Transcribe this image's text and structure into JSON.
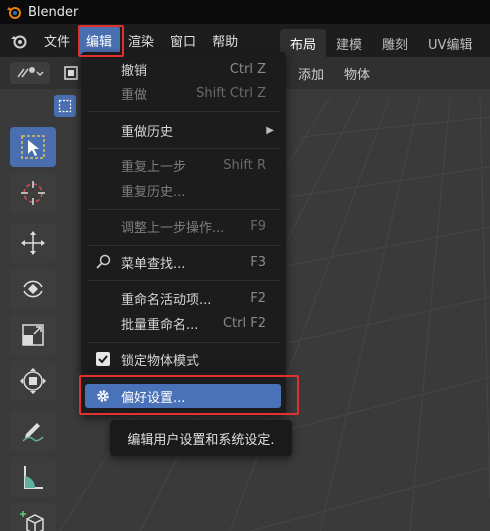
{
  "window": {
    "title": "Blender"
  },
  "menubar": {
    "items": [
      {
        "label": "文件"
      },
      {
        "label": "编辑"
      },
      {
        "label": "渲染"
      },
      {
        "label": "窗口"
      },
      {
        "label": "帮助"
      }
    ],
    "active_index": 1
  },
  "workspaces": [
    {
      "label": "布局"
    },
    {
      "label": "建模"
    },
    {
      "label": "雕刻"
    },
    {
      "label": "UV编辑"
    }
  ],
  "viewport_header": {
    "add_label": "添加",
    "object_label": "物体"
  },
  "edit_menu": {
    "undo": {
      "label": "撤销",
      "shortcut": "Ctrl Z"
    },
    "redo": {
      "label": "重做",
      "shortcut": "Shift Ctrl Z"
    },
    "undo_history": {
      "label": "重做历史"
    },
    "repeat_last": {
      "label": "重复上一步",
      "shortcut": "Shift R"
    },
    "repeat_history": {
      "label": "重复历史..."
    },
    "adjust_last": {
      "label": "调整上一步操作...",
      "shortcut": "F9"
    },
    "menu_search": {
      "label": "菜单查找...",
      "shortcut": "F3"
    },
    "rename_active": {
      "label": "重命名活动项...",
      "shortcut": "F2"
    },
    "batch_rename": {
      "label": "批量重命名...",
      "shortcut": "Ctrl F2"
    },
    "lock_object_modes": {
      "label": "锁定物体模式",
      "checked": true
    },
    "preferences": {
      "label": "偏好设置..."
    }
  },
  "tooltip": {
    "text": "编辑用户设置和系统设定."
  },
  "colors": {
    "highlight": "#4a72b8",
    "active_menu": "#4a6fb0",
    "callout": "#e03030"
  }
}
